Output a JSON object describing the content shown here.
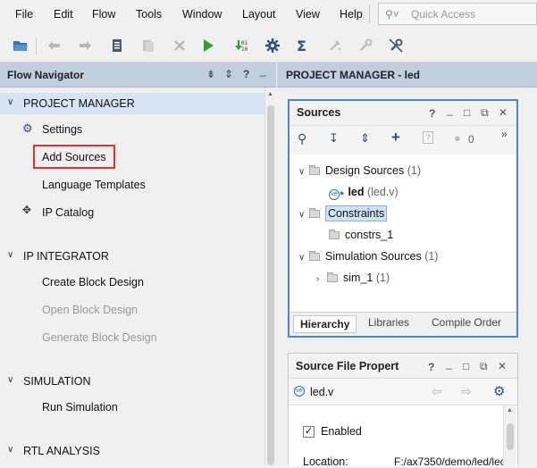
{
  "menubar": {
    "items": [
      "File",
      "Edit",
      "Flow",
      "Tools",
      "Window",
      "Layout",
      "View",
      "Help"
    ],
    "quick_access_placeholder": "Quick Access"
  },
  "toolbar": {
    "icons": [
      "open-project-icon",
      "undo-icon",
      "redo-icon",
      "copy-icon",
      "paste-icon",
      "delete-icon",
      "run-icon",
      "generate-bitstream-icon",
      "settings-icon",
      "sigma-report-icon",
      "tools-icon",
      "wrench-icon",
      "cancel-icon"
    ]
  },
  "flow_navigator": {
    "title": "Flow Navigator",
    "header_controls": [
      "⇟",
      "⇕",
      "?",
      "_"
    ],
    "sections": [
      {
        "label": "PROJECT MANAGER",
        "active": true,
        "items": [
          {
            "label": "Settings",
            "icon": "gear-icon",
            "enabled": true
          },
          {
            "label": "Add Sources",
            "icon": "",
            "enabled": true,
            "highlighted": true
          },
          {
            "label": "Language Templates",
            "icon": "",
            "enabled": true
          },
          {
            "label": "IP Catalog",
            "icon": "ip-catalog-icon",
            "enabled": true
          }
        ]
      },
      {
        "label": "IP INTEGRATOR",
        "active": false,
        "items": [
          {
            "label": "Create Block Design",
            "enabled": true
          },
          {
            "label": "Open Block Design",
            "enabled": false
          },
          {
            "label": "Generate Block Design",
            "enabled": false
          }
        ]
      },
      {
        "label": "SIMULATION",
        "active": false,
        "items": [
          {
            "label": "Run Simulation",
            "enabled": true
          }
        ]
      },
      {
        "label": "RTL ANALYSIS",
        "active": false,
        "items": []
      }
    ]
  },
  "project_manager": {
    "title": "PROJECT MANAGER - led"
  },
  "sources": {
    "title": "Sources",
    "header_controls": [
      "?",
      "_",
      "□",
      "⧉",
      "✕"
    ],
    "error_count": "0",
    "tree": {
      "design_sources": {
        "label": "Design Sources",
        "count": "(1)"
      },
      "led": {
        "label": "led",
        "file": "(led.v)"
      },
      "constraints": {
        "label": "Constraints"
      },
      "constrs_1": {
        "label": "constrs_1"
      },
      "simulation_sources": {
        "label": "Simulation Sources",
        "count": "(1)"
      },
      "sim_1": {
        "label": "sim_1",
        "count": "(1)"
      }
    },
    "tabs": [
      "Hierarchy",
      "Libraries",
      "Compile Order"
    ],
    "active_tab": "Hierarchy"
  },
  "source_file_properties": {
    "title": "Source File Propert",
    "header_controls": [
      "?",
      "_",
      "□",
      "⧉",
      "✕"
    ],
    "file_name": "led.v",
    "enabled_label": "Enabled",
    "enabled_checked": true,
    "location_label": "Location:",
    "location_value": "F:/ax7350/demo/led/lec"
  },
  "colors": {
    "header_bg": "#c0cede",
    "active_section_bg": "#d5e3f5",
    "highlight_box": "#e0322b",
    "sources_border": "#4f86c6",
    "run_green": "#2f9e3a"
  }
}
